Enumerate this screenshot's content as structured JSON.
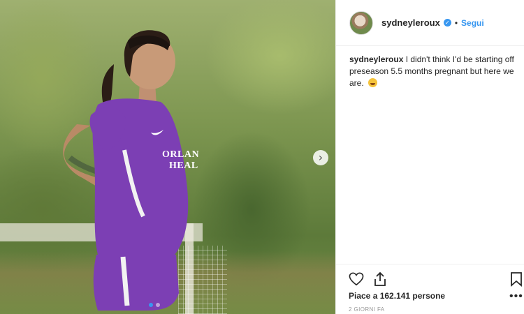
{
  "post": {
    "username": "sydneyleroux",
    "verified": true,
    "follow_label": "Segui",
    "separator": "•",
    "caption_user": "sydneyleroux",
    "caption_text": "I didn't think I'd be starting off preseason 5.5 months pregnant but here we are.",
    "caption_emoji": "grinning-face-sweat-emoji",
    "jersey_text_line1": "ORLAN",
    "jersey_text_line2": "HEAL",
    "likes_text": "Piace a 162.141 persone",
    "time_text": "2 GIORNI FA",
    "more_text": "•••"
  },
  "carousel": {
    "slide_count": 2,
    "active_slide": 1,
    "next_glyph": "›"
  },
  "icons": {
    "like": "heart-icon",
    "share": "share-icon",
    "save": "bookmark-icon",
    "more": "more-options-icon",
    "verified": "verified-badge-icon"
  },
  "colors": {
    "accent": "#3897f0",
    "jersey": "#7c3fb4",
    "text": "#262626",
    "muted": "#999999"
  }
}
